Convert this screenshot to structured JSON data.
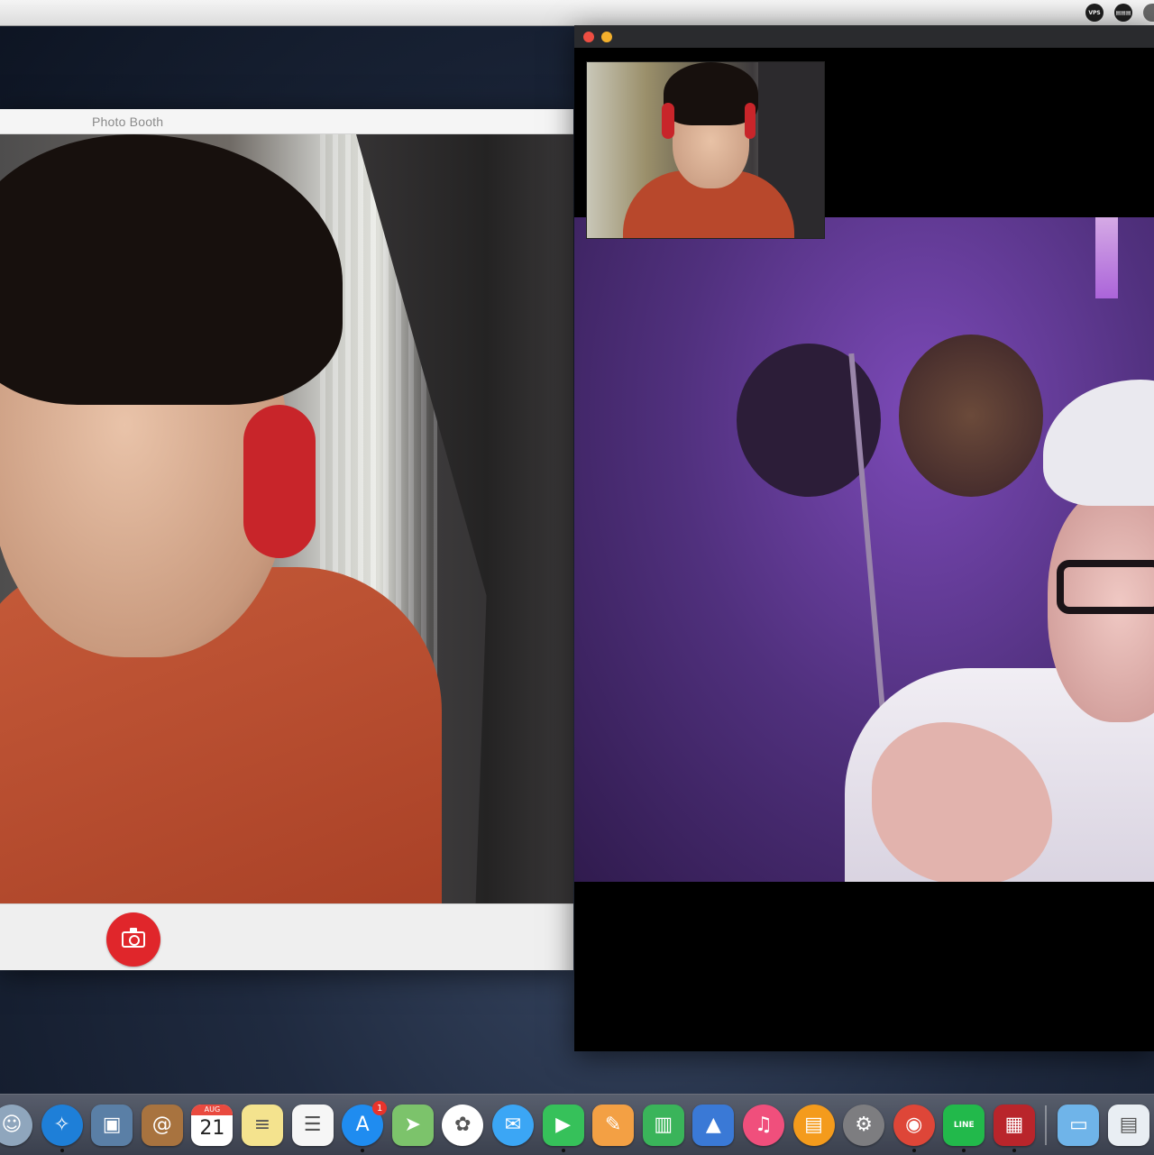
{
  "menubar": {
    "icons": [
      {
        "name": "status-bubble-icon",
        "label": "VPS"
      },
      {
        "name": "keyboard-icon",
        "label": "▤▤▤"
      }
    ]
  },
  "photobooth": {
    "title": "Photo Booth",
    "shutter_icon": "camera-icon",
    "shutter_color": "#e0262b"
  },
  "facetime": {
    "window_buttons": [
      "close",
      "minimize"
    ],
    "remote_video": "remote-caller",
    "self_preview": "self-view"
  },
  "dock": {
    "items": [
      {
        "name": "finder",
        "icon": "finder-icon",
        "color": "#8fa6bd",
        "running": false
      },
      {
        "name": "safari",
        "icon": "compass-icon",
        "color": "#1e7fd8",
        "running": true
      },
      {
        "name": "preview",
        "icon": "preview-icon",
        "color": "#5a7fa6",
        "running": false
      },
      {
        "name": "contacts",
        "icon": "contacts-icon",
        "color": "#a8733f",
        "running": false
      },
      {
        "name": "calendar",
        "icon": "calendar-icon",
        "color": "#ffffff",
        "month": "AUG",
        "day": "21",
        "running": false
      },
      {
        "name": "notes",
        "icon": "notes-icon",
        "color": "#f4e38e",
        "running": false
      },
      {
        "name": "reminders",
        "icon": "reminders-icon",
        "color": "#f6f6f6",
        "running": false
      },
      {
        "name": "app-store",
        "icon": "app-store-icon",
        "color": "#1f8cf0",
        "badge": "1",
        "running": true
      },
      {
        "name": "maps",
        "icon": "maps-icon",
        "color": "#7cc36b",
        "running": false
      },
      {
        "name": "photos",
        "icon": "photos-icon",
        "color": "#ffffff",
        "running": false
      },
      {
        "name": "messages",
        "icon": "messages-icon",
        "color": "#3ba6f5",
        "running": false
      },
      {
        "name": "facetime",
        "icon": "facetime-icon",
        "color": "#36c15a",
        "running": true
      },
      {
        "name": "pages",
        "icon": "pages-icon",
        "color": "#f3a044",
        "running": false
      },
      {
        "name": "numbers",
        "icon": "numbers-icon",
        "color": "#3ab45a",
        "running": false
      },
      {
        "name": "keynote",
        "icon": "keynote-icon",
        "color": "#3a79d6",
        "running": false
      },
      {
        "name": "itunes",
        "icon": "music-note-icon",
        "color": "#f04f7c",
        "running": false
      },
      {
        "name": "ibooks",
        "icon": "book-icon",
        "color": "#f49b1c",
        "running": false
      },
      {
        "name": "system-preferences",
        "icon": "gear-icon",
        "color": "#7d7d80",
        "running": false
      },
      {
        "name": "chrome",
        "icon": "chrome-icon",
        "color": "#de4638",
        "running": true
      },
      {
        "name": "line",
        "icon": "line-icon",
        "color": "#22b94b",
        "label": "LINE",
        "running": true
      },
      {
        "name": "photo-booth",
        "icon": "photo-booth-icon",
        "color": "#b9252b",
        "running": true
      }
    ],
    "right_items": [
      {
        "name": "downloads-folder",
        "icon": "folder-icon",
        "color": "#6fb4e9"
      },
      {
        "name": "documents-stack",
        "icon": "stack-icon",
        "color": "#e9eef3"
      }
    ]
  }
}
